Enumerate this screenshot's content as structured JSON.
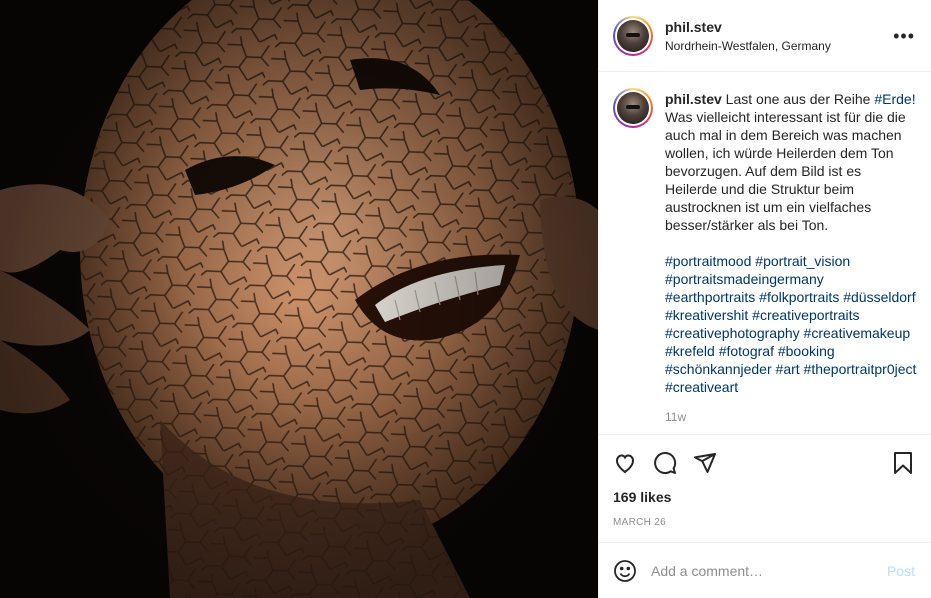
{
  "post": {
    "username": "phil.stev",
    "location": "Nordrhein-Westfalen, Germany",
    "more_label": "•••",
    "photo_icon": "cracked-clay-face-photo"
  },
  "caption": {
    "username": "phil.stev",
    "text_before_tag": " Last one aus der Reihe ",
    "inline_tag": "#Erde!",
    "text_after_tag": " Was vielleicht interessant ist für die die auch mal in dem Bereich was machen wollen, ich würde Heilerden dem Ton bevorzugen. Auf dem Bild ist es Heilerde und die Struktur beim austrocknen ist um ein vielfaches besser/stärker als bei Ton.",
    "hashtags": [
      "#portraitmood",
      "#portrait_vision",
      "#portraitsmadeingermany",
      "#earthportraits",
      "#folkportraits",
      "#düsseldorf",
      "#kreativershit",
      "#creativeportraits",
      "#creativephotography",
      "#creativemakeup",
      "#krefeld",
      "#fotograf",
      "#booking",
      "#schönkannjeder",
      "#art",
      "#theportraitpr0ject",
      "#creativeart"
    ],
    "time_ago": "11w"
  },
  "actions": {
    "icons": [
      "heart-icon",
      "comment-icon",
      "share-icon",
      "bookmark-icon"
    ],
    "likes": "169 likes",
    "date": "MARCH 26"
  },
  "comment_box": {
    "placeholder": "Add a comment…",
    "post_label": "Post",
    "emoji_icon": "smiley-icon"
  },
  "colors": {
    "hashtag": "#00376b",
    "muted": "#8e8e8e",
    "post_button_disabled": "#b2dffc",
    "border": "#efefef"
  }
}
